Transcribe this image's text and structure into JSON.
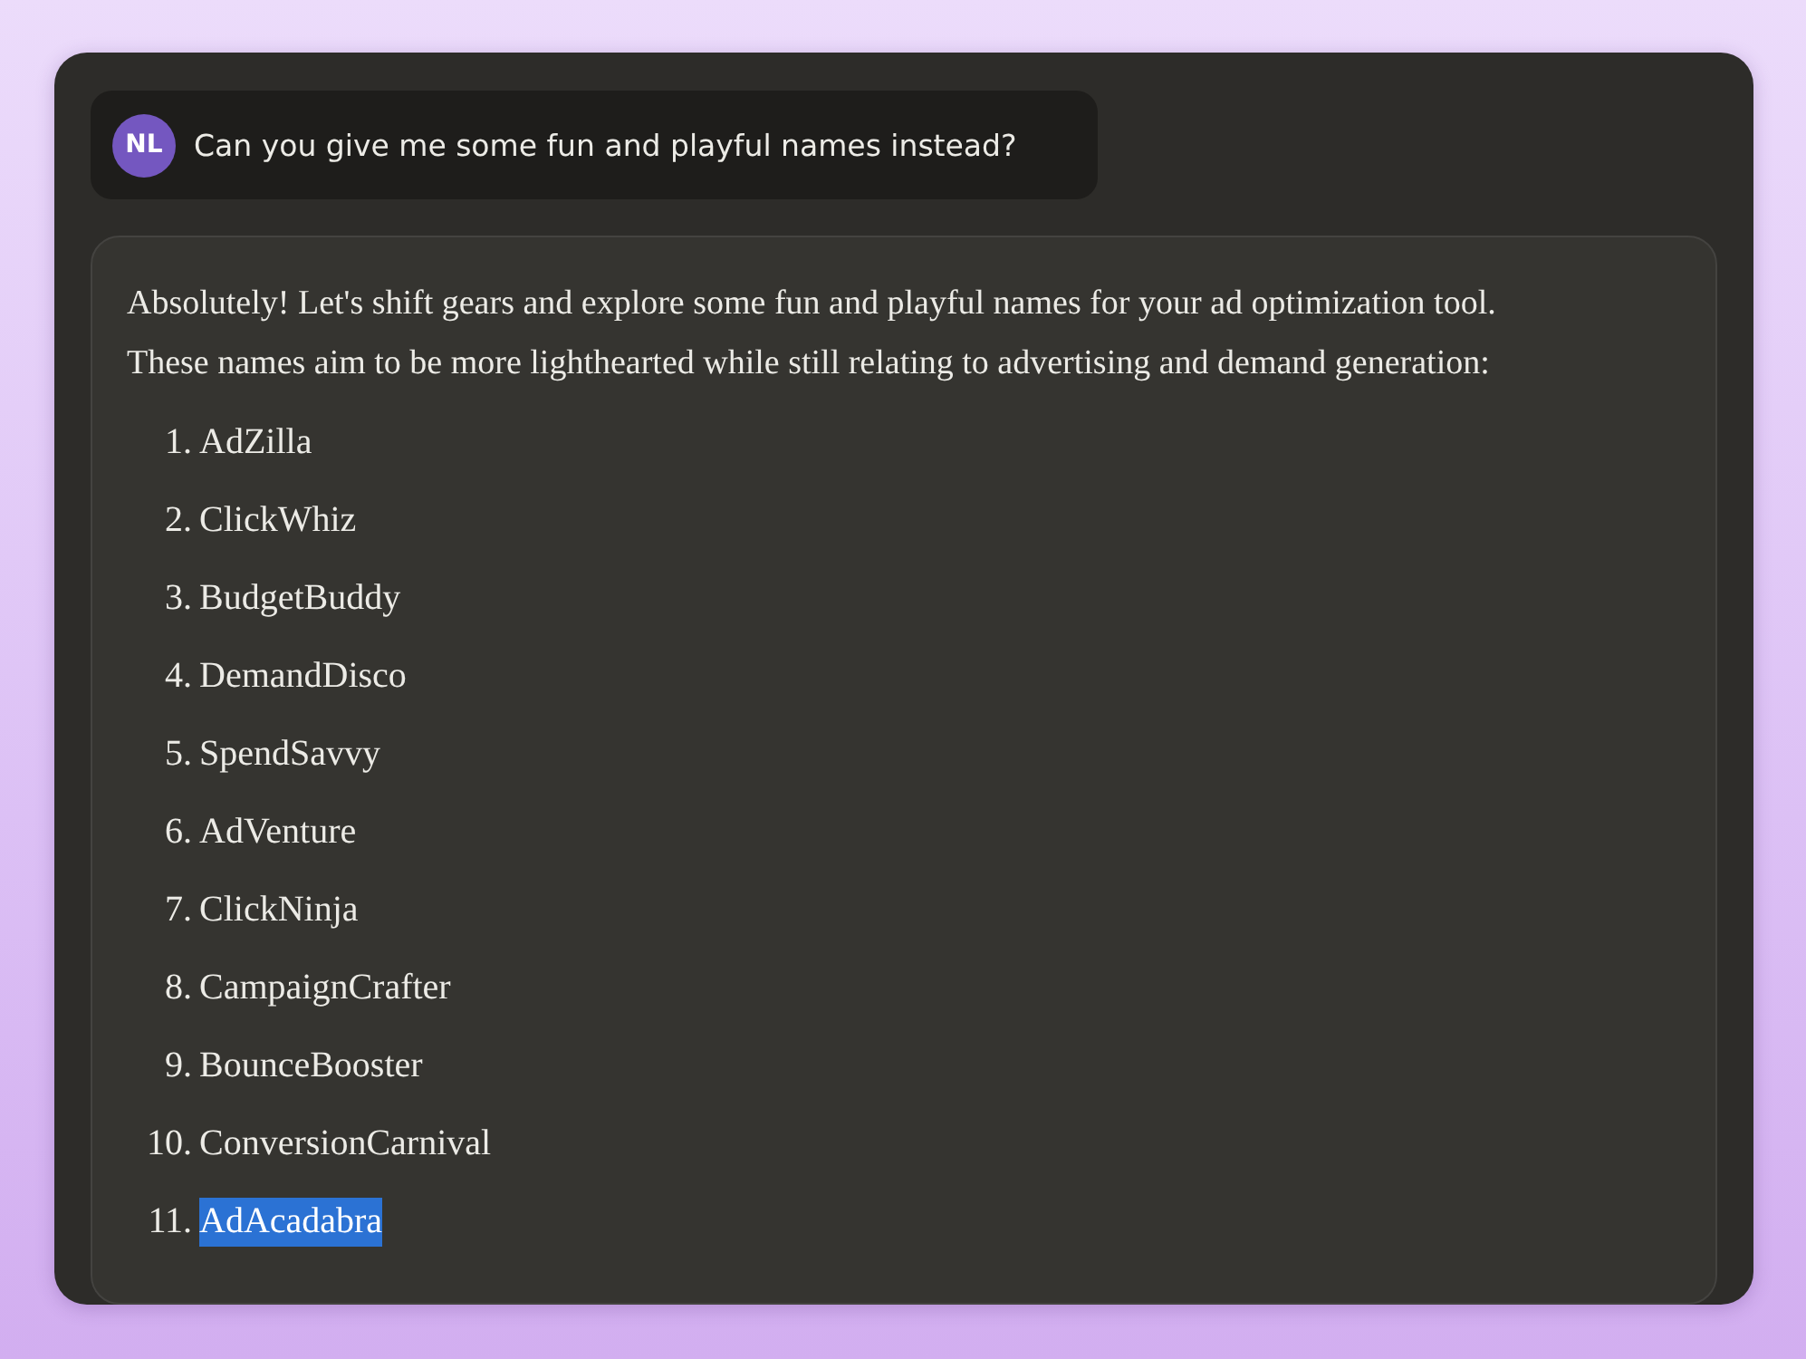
{
  "user_message": {
    "avatar": "NL",
    "text": "Can you give me some fun and playful names instead?"
  },
  "response": {
    "intro": "Absolutely! Let's shift gears and explore some fun and playful names for your ad optimization tool. These names aim to be more lighthearted while still relating to advertising and demand generation:",
    "items": [
      {
        "number": "1.",
        "name": "AdZilla",
        "selected": false
      },
      {
        "number": "2.",
        "name": "ClickWhiz",
        "selected": false
      },
      {
        "number": "3.",
        "name": "BudgetBuddy",
        "selected": false
      },
      {
        "number": "4.",
        "name": "DemandDisco",
        "selected": false
      },
      {
        "number": "5.",
        "name": "SpendSavvy",
        "selected": false
      },
      {
        "number": "6.",
        "name": "AdVenture",
        "selected": false
      },
      {
        "number": "7.",
        "name": "ClickNinja",
        "selected": false
      },
      {
        "number": "8.",
        "name": "CampaignCrafter",
        "selected": false
      },
      {
        "number": "9.",
        "name": "BounceBooster",
        "selected": false
      },
      {
        "number": "10.",
        "name": "ConversionCarnival",
        "selected": false
      },
      {
        "number": "11.",
        "name": "AdAcadabra",
        "selected": true
      }
    ]
  }
}
